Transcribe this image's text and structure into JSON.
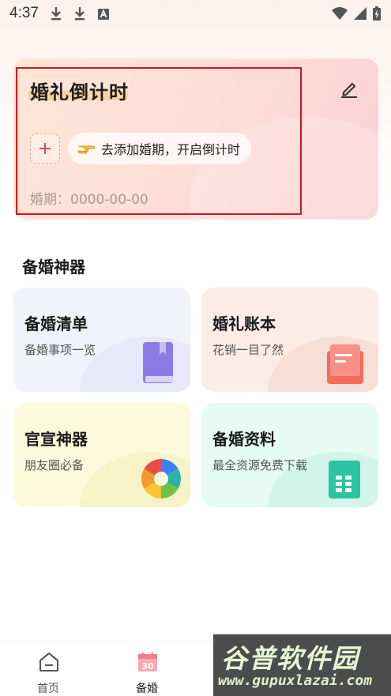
{
  "status_bar": {
    "time": "4:37",
    "notification_icons": [
      "download-icon",
      "download-icon",
      "text-a-icon"
    ],
    "system_icons": [
      "wifi-icon",
      "signal-icon",
      "battery-charging-icon"
    ]
  },
  "countdown": {
    "title": "婚礼倒计时",
    "add_hint": "去添加婚期，开启倒计时",
    "date_label": "婚期：0000-00-00",
    "edit_icon": "edit-pencil-icon",
    "add_icon": "plus-icon",
    "hint_icon": "pointing-hand-icon"
  },
  "tools": {
    "section_title": "备婚神器",
    "items": [
      {
        "title": "备婚清单",
        "subtitle": "备婚事项一览",
        "icon": "book-icon"
      },
      {
        "title": "婚礼账本",
        "subtitle": "花销一目了然",
        "icon": "ledger-icon"
      },
      {
        "title": "官宣神器",
        "subtitle": "朋友圈必备",
        "icon": "camera-aperture-icon"
      },
      {
        "title": "备婚资料",
        "subtitle": "最全资源免费下载",
        "icon": "spreadsheet-icon"
      }
    ]
  },
  "bottom_nav": {
    "items": [
      {
        "label": "首页",
        "icon": "home-icon"
      },
      {
        "label": "备婚",
        "icon": "calendar-30-icon",
        "calendar_text": "30"
      }
    ]
  },
  "watermark": {
    "title": "谷普软件园",
    "url": "www.gupuxlazai.com"
  },
  "colors": {
    "highlight_border": "#d9121b",
    "plus": "#e0475c",
    "ledger": "#f26b5b",
    "book": "#8c7be6",
    "sheet": "#2bc3a0"
  }
}
